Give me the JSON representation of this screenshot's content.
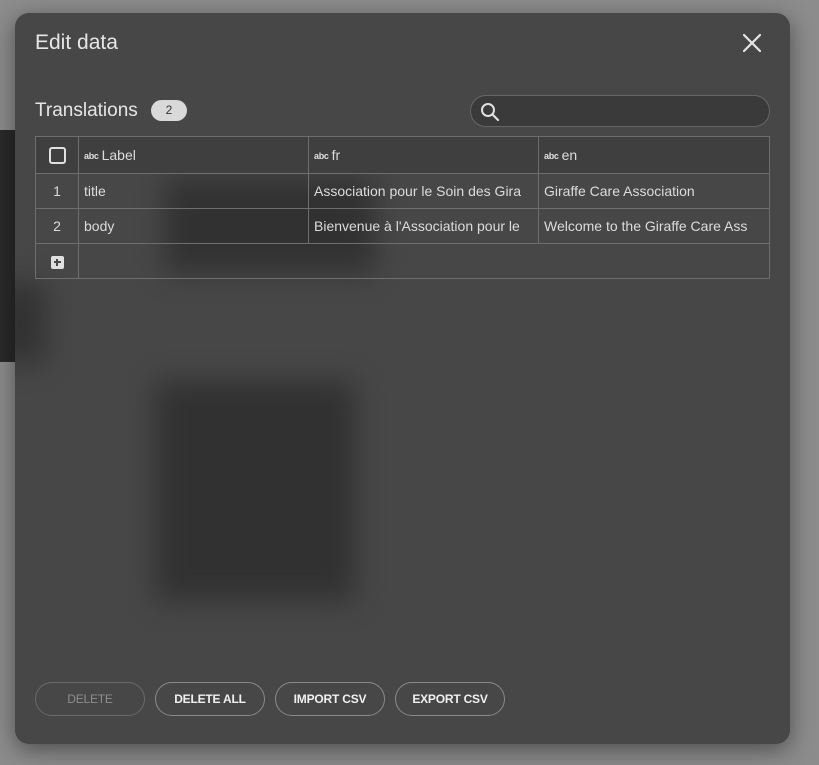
{
  "modal": {
    "title": "Edit data",
    "close_icon": "close-icon"
  },
  "section": {
    "title": "Translations",
    "count": "2"
  },
  "search": {
    "placeholder": "",
    "value": ""
  },
  "table": {
    "columns": [
      {
        "type_icon": "abc",
        "label": "Label"
      },
      {
        "type_icon": "abc",
        "label": "fr"
      },
      {
        "type_icon": "abc",
        "label": "en"
      }
    ],
    "rows": [
      {
        "index": "1",
        "label": "title",
        "fr": "Association pour le Soin des Gira",
        "en": "Giraffe Care Association"
      },
      {
        "index": "2",
        "label": "body",
        "fr": "Bienvenue à l'Association pour le",
        "en": "Welcome to the Giraffe Care Ass"
      }
    ]
  },
  "footer": {
    "delete_label": "DELETE",
    "delete_all_label": "DELETE ALL",
    "import_label": "IMPORT CSV",
    "export_label": "EXPORT CSV"
  }
}
